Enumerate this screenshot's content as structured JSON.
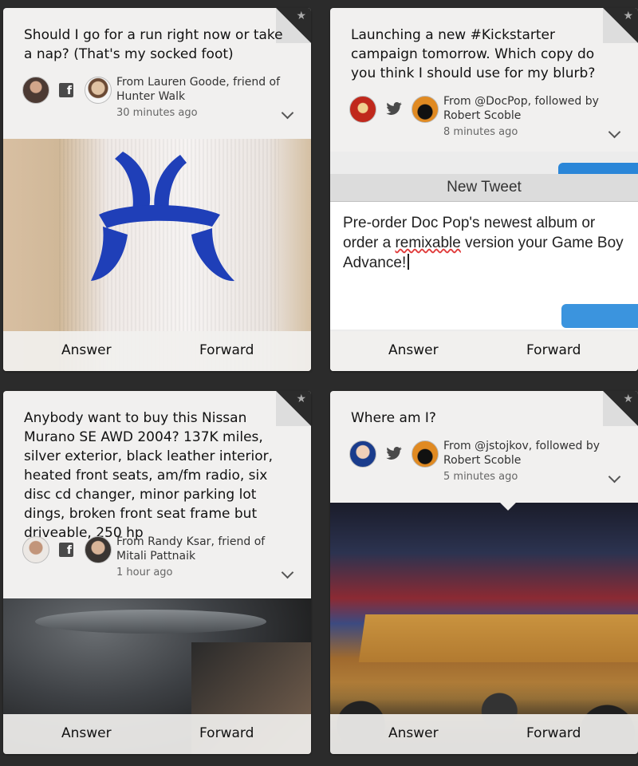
{
  "cards": [
    {
      "question": "Should I go for a run right now or take a nap? (That's my socked foot)",
      "network": "facebook",
      "from_line1": "From Lauren Goode, friend of",
      "from_line2": "Hunter Walk",
      "time": "30 minutes ago",
      "answer_label": "Answer",
      "forward_label": "Forward"
    },
    {
      "question": "Launching a new #Kickstarter campaign tomorrow. Which copy do you think I should use for my blurb?",
      "network": "twitter",
      "from_line1": "From @DocPop, followed by",
      "from_line2": "Robert Scoble",
      "time": "8 minutes ago",
      "answer_label": "Answer",
      "forward_label": "Forward",
      "screenshot": {
        "window_title": "New Tweet",
        "tweet_text_part1": "Pre-order Doc Pop's newest album or order a ",
        "tweet_text_misspelled": "remixable",
        "tweet_text_part2": " version your Game Boy Advance!"
      }
    },
    {
      "question": "Anybody want to buy this Nissan Murano SE AWD 2004? 137K miles, silver exterior, black leather interior, heated front seats, am/fm radio, six disc cd changer, minor parking lot dings, broken front seat frame but driveable, 250 hp",
      "network": "facebook",
      "from_line1": "From Randy Ksar, friend of",
      "from_line2": "Mitali Pattnaik",
      "time": "1 hour ago",
      "answer_label": "Answer",
      "forward_label": "Forward"
    },
    {
      "question": "Where am I?",
      "network": "twitter",
      "from_line1": "From @jstojkov, followed by",
      "from_line2": "Robert Scoble",
      "time": "5 minutes ago",
      "answer_label": "Answer",
      "forward_label": "Forward"
    }
  ],
  "icons": {
    "star": "star-icon",
    "facebook": "facebook-icon",
    "twitter": "twitter-icon",
    "expand": "chevron-down-icon"
  },
  "colors": {
    "background": "#2b2b2b",
    "card": "#f1f0ef",
    "twitter_blue": "#2a86d8",
    "sock_logo_blue": "#1f3fb8"
  }
}
